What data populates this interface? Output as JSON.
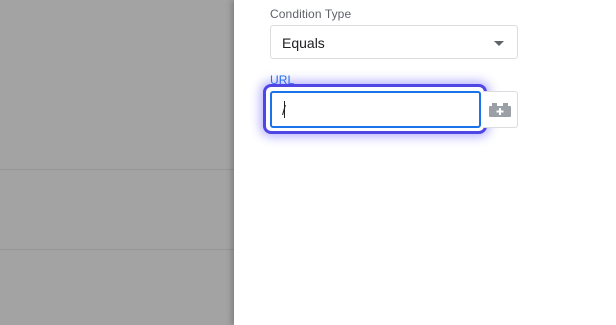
{
  "condition_type": {
    "label": "Condition Type",
    "selected_value": "Equals"
  },
  "url_field": {
    "label": "URL",
    "value": "/"
  },
  "colors": {
    "overlay": "#a3a3a3",
    "accent": "#1a73e8",
    "focus_ring": "#4f46e5"
  },
  "icons": {
    "variable_picker": "brick-plus-icon",
    "dropdown": "caret-down-icon"
  }
}
